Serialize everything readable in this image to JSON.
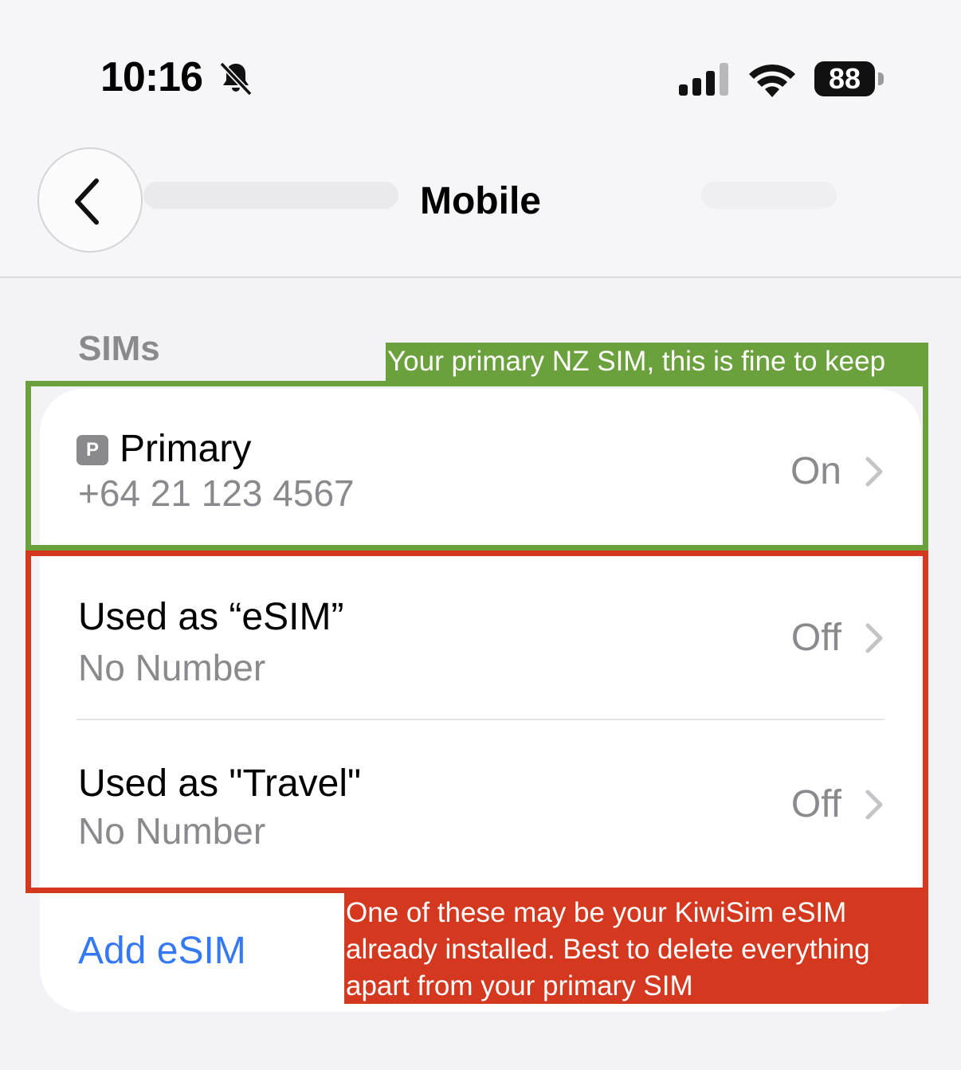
{
  "status_bar": {
    "time": "10:16",
    "battery_percent": "88",
    "icons": [
      "bell-slash-icon",
      "cellular-signal-icon",
      "wifi-icon",
      "battery-icon"
    ]
  },
  "nav": {
    "title": "Mobile",
    "back_icon": "chevron-left-icon"
  },
  "sims": {
    "header": "SIMs",
    "rows": [
      {
        "badge": "P",
        "title": "Primary",
        "subtitle": "+64 21 123 4567",
        "value": "On"
      },
      {
        "title": "Used as “eSIM”",
        "subtitle": "No Number",
        "value": "Off"
      },
      {
        "title": "Used as \"Travel\"",
        "subtitle": "No Number",
        "value": "Off"
      }
    ],
    "add_label": "Add eSIM"
  },
  "annotations": {
    "green": {
      "color": "#6aa13d",
      "text": "Your primary NZ SIM, this is fine to keep"
    },
    "red": {
      "color": "#d4381f",
      "lines": [
        "One of these may be your KiwiSim eSIM",
        "already installed. Best to delete everything",
        "apart from your primary SIM"
      ]
    }
  },
  "colors": {
    "accent": "#3478f6",
    "secondary_text": "#8a8a8e",
    "background": "#f2f2f7"
  }
}
